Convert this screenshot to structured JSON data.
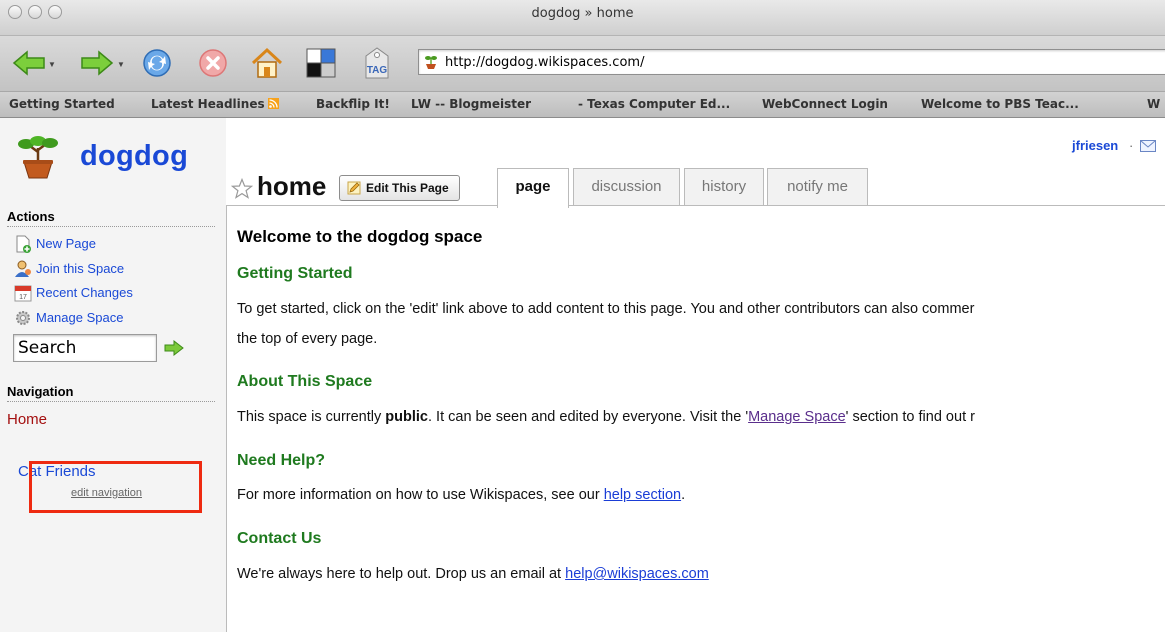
{
  "window": {
    "title": "dogdog » home"
  },
  "toolbar": {
    "url": "http://dogdog.wikispaces.com/",
    "tag_label": "TAG"
  },
  "bookmarks": [
    "Getting Started",
    "Latest Headlines",
    "Backflip It!",
    "LW -- Blogmeister",
    "- Texas Computer Ed...",
    "WebConnect Login",
    "Welcome to PBS Teac...",
    "W"
  ],
  "sidebar": {
    "space_name": "dogdog",
    "actions_heading": "Actions",
    "actions": [
      {
        "label": "New Page",
        "icon": "new-page-icon"
      },
      {
        "label": "Join this Space",
        "icon": "join-space-icon"
      },
      {
        "label": "Recent Changes",
        "icon": "calendar-icon"
      },
      {
        "label": "Manage Space",
        "icon": "gear-icon"
      }
    ],
    "search_value": "Search",
    "navigation_heading": "Navigation",
    "nav_items": [
      "Home",
      "Cat Friends"
    ],
    "edit_navigation": "edit navigation"
  },
  "user": {
    "name": "jfriesen",
    "separator": "·"
  },
  "page": {
    "title": "home",
    "edit_button": "Edit This Page",
    "tabs": [
      "page",
      "discussion",
      "history",
      "notify me"
    ],
    "active_tab": "page"
  },
  "content": {
    "heading": "Welcome to the dogdog space",
    "getting_started": {
      "heading": "Getting Started",
      "line1": "To get started, click on the 'edit' link above to add content to this page. You and other contributors can also commer",
      "line2": "the top of every page."
    },
    "about": {
      "heading": "About This Space",
      "pre": "This space is currently ",
      "bold": "public",
      "mid": ". It can be seen and edited by everyone. Visit the '",
      "link": "Manage Space",
      "post": "' section to find out r"
    },
    "help": {
      "heading": "Need Help?",
      "pre": "For more information on how to use Wikispaces, see our ",
      "link": "help section",
      "post": "."
    },
    "contact": {
      "heading": "Contact Us",
      "pre": "We're always here to help out. Drop us an email at ",
      "link": "help@wikispaces.com"
    }
  },
  "colors": {
    "link_blue": "#1a49d6",
    "heading_green": "#1f7a1f",
    "highlight_red": "#ee2a10"
  }
}
